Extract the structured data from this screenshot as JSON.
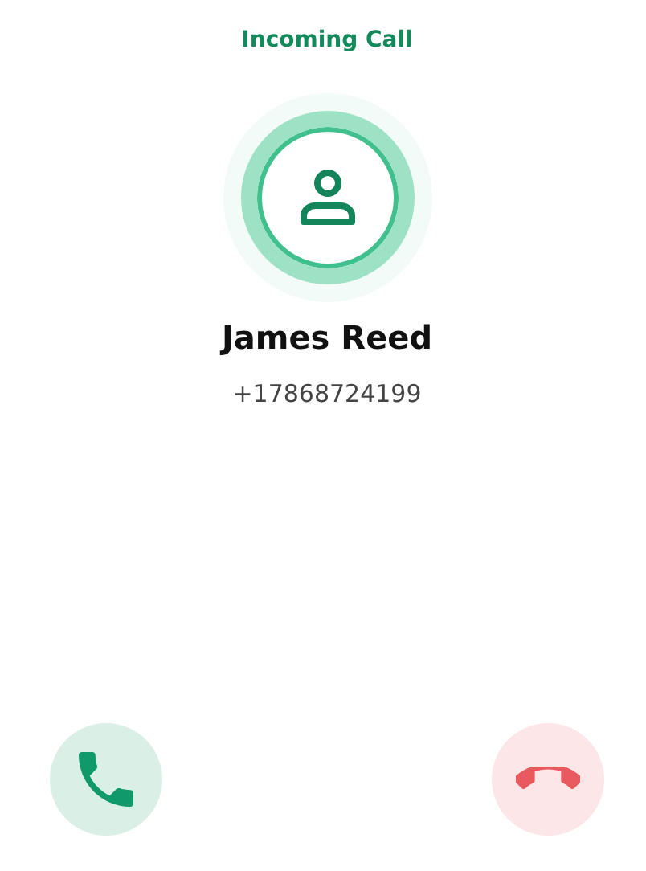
{
  "header": {
    "title": "Incoming Call"
  },
  "caller": {
    "name": "James Reed",
    "number": "+17868724199"
  },
  "actions": [
    {
      "kind": "accept"
    },
    {
      "kind": "decline"
    }
  ]
}
